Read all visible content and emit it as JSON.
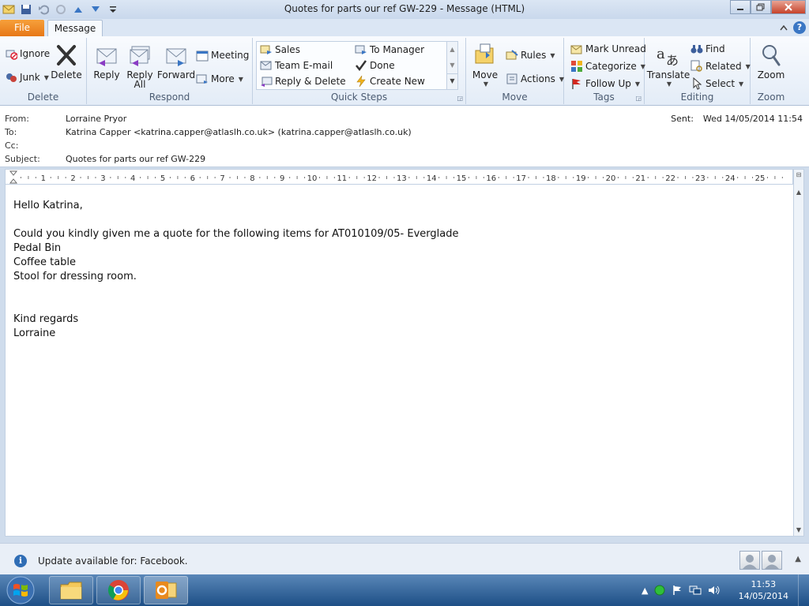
{
  "window": {
    "title": "Quotes for parts our ref GW-229  -  Message (HTML)"
  },
  "tabs": {
    "file": "File",
    "message": "Message"
  },
  "ribbon": {
    "delete_group": {
      "label": "Delete",
      "ignore": "Ignore",
      "junk": "Junk",
      "delete": "Delete"
    },
    "respond_group": {
      "label": "Respond",
      "reply": "Reply",
      "reply_all_1": "Reply",
      "reply_all_2": "All",
      "forward": "Forward",
      "meeting": "Meeting",
      "more": "More"
    },
    "quicksteps_group": {
      "label": "Quick Steps",
      "items": [
        "Sales",
        "To Manager",
        "Team E-mail",
        "Done",
        "Reply & Delete",
        "Create New"
      ]
    },
    "move_group": {
      "label": "Move",
      "move": "Move",
      "rules": "Rules",
      "actions": "Actions"
    },
    "tags_group": {
      "label": "Tags",
      "mark_unread": "Mark Unread",
      "categorize": "Categorize",
      "follow_up": "Follow Up"
    },
    "editing_group": {
      "label": "Editing",
      "translate": "Translate",
      "find": "Find",
      "related": "Related",
      "select": "Select"
    },
    "zoom_group": {
      "label": "Zoom",
      "zoom": "Zoom"
    }
  },
  "header": {
    "from_label": "From:",
    "from_value": "Lorraine Pryor",
    "to_label": "To:",
    "to_value": "Katrina Capper <katrina.capper@atlaslh.co.uk> (katrina.capper@atlaslh.co.uk)",
    "cc_label": "Cc:",
    "cc_value": "",
    "subject_label": "Subject:",
    "subject_value": "Quotes for parts our ref GW-229",
    "sent_label": "Sent:",
    "sent_value": "Wed 14/05/2014 11:54"
  },
  "ruler": {
    "numbers": [
      "1",
      "2",
      "3",
      "4",
      "5",
      "6",
      "7",
      "8",
      "9",
      "10",
      "11",
      "12",
      "13",
      "14",
      "15",
      "16",
      "17",
      "18",
      "19",
      "20",
      "21",
      "22",
      "23",
      "24",
      "25"
    ]
  },
  "body": {
    "lines": [
      "Hello Katrina,",
      "",
      "Could you kindly given me a quote for the following items for AT010109/05- Everglade",
      "Pedal Bin",
      "Coffee table",
      "Stool for dressing room.",
      "",
      "",
      "Kind regards",
      "Lorraine"
    ]
  },
  "people_pane": {
    "update_text": "Update available for: Facebook."
  },
  "taskbar": {
    "time": "11:53",
    "date": "14/05/2014"
  },
  "colors": {
    "file_tab": "#e77817",
    "accent_blue": "#3a76c4",
    "taskbar": "#1d4f86"
  }
}
